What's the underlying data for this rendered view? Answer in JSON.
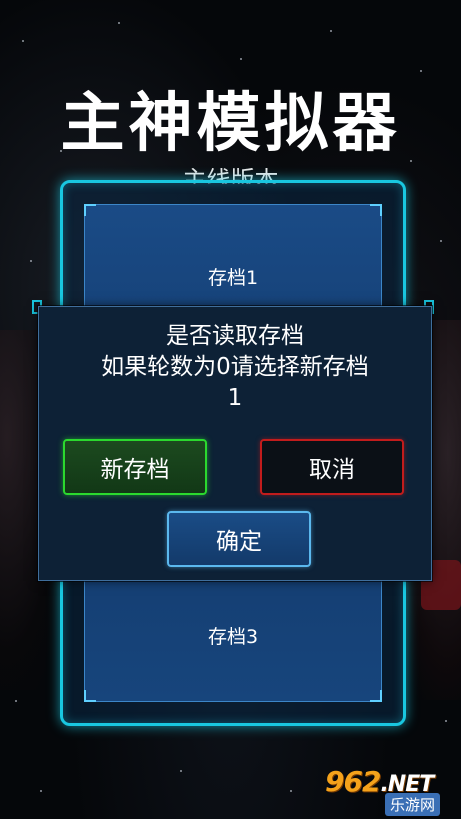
{
  "game": {
    "title": "主神模拟器",
    "subtitle": "主线版本"
  },
  "saves": {
    "slot1_label": "存档1",
    "slot3_label": "存档3"
  },
  "dialog": {
    "line1": "是否读取存档",
    "line2": "如果轮数为0请选择新存档",
    "line3": "1",
    "new_save_label": "新存档",
    "cancel_label": "取消",
    "confirm_label": "确定"
  },
  "watermark": {
    "logo": "962",
    "logo_suffix": ".NET",
    "sub": "乐游网"
  },
  "colors": {
    "frame_cyan": "#19c7e0",
    "new_green": "#2bd92e",
    "cancel_red": "#c21c1c",
    "confirm_blue": "#5bb8ee",
    "watermark_orange": "#f4a21b"
  }
}
